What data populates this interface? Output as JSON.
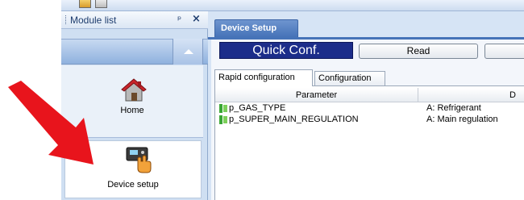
{
  "module_list": {
    "title": "Module list",
    "pin_glyph": "ᴩ",
    "close_glyph": "×",
    "items": [
      {
        "label": "Home",
        "icon": "home-icon"
      },
      {
        "label": "Device setup",
        "icon": "device-icon"
      }
    ]
  },
  "document": {
    "tab_label": "Device Setup",
    "quick_conf_label": "Quick Conf.",
    "read_button_label": "Read",
    "subtabs": [
      {
        "label": "Rapid configuration",
        "active": true
      },
      {
        "label": "Configuration",
        "active": false
      }
    ],
    "grid": {
      "columns": [
        "Parameter",
        "D"
      ],
      "rows": [
        {
          "parameter": "p_GAS_TYPE",
          "description": "A: Refrigerant"
        },
        {
          "parameter": "p_SUPER_MAIN_REGULATION",
          "description": "A: Main regulation"
        }
      ]
    }
  },
  "colors": {
    "accent": "#1c2d8a",
    "tab_blue": "#4673b8",
    "arrow": "#e8141c"
  }
}
